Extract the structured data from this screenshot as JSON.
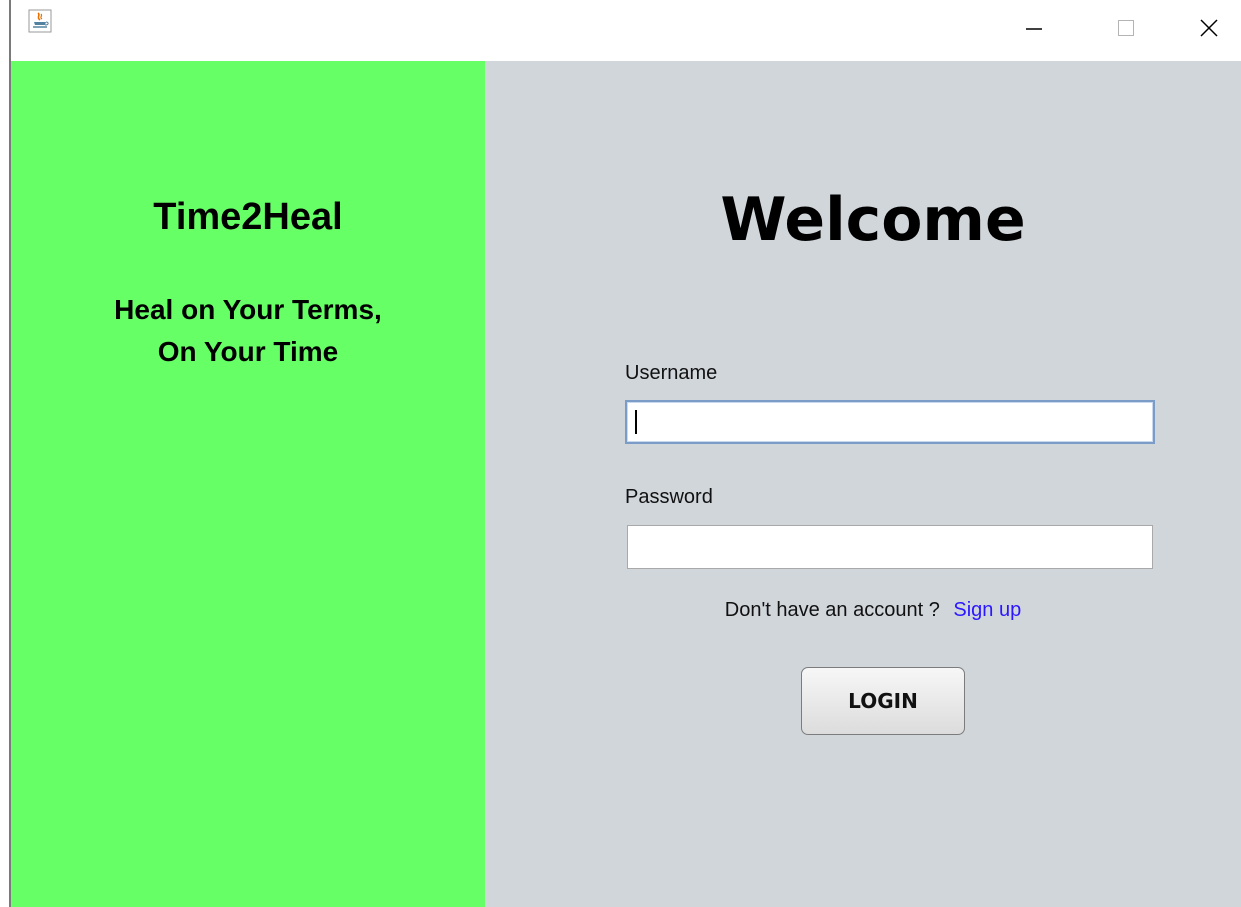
{
  "left_panel": {
    "brand": "Time2Heal",
    "tagline_line1": "Heal on Your Terms,",
    "tagline_line2": "On Your Time",
    "bg_color": "#66ff66"
  },
  "right_panel": {
    "heading": "Welcome",
    "username_label": "Username",
    "username_value": "",
    "password_label": "Password",
    "password_value": "",
    "signup_prompt": "Don't have an account ?",
    "signup_link": "Sign up",
    "login_label": "LOGIN",
    "bg_color": "#d1d6db",
    "link_color": "#2b17ff"
  },
  "titlebar": {
    "icons": [
      "java-app-icon",
      "minimize-icon",
      "maximize-icon",
      "close-icon"
    ]
  }
}
